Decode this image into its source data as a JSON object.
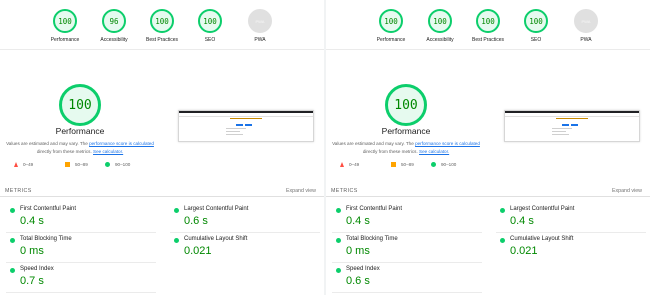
{
  "reports": [
    {
      "gauges": [
        {
          "score": "100",
          "label": "Performance"
        },
        {
          "score": "96",
          "label": "Accessibility"
        },
        {
          "score": "100",
          "label": "Best Practices"
        },
        {
          "score": "100",
          "label": "SEO"
        },
        {
          "score": "PWA",
          "label": "PWA"
        }
      ],
      "hero": {
        "score": "100",
        "title": "Performance",
        "desc_prefix": "Values are estimated and may vary. The ",
        "desc_link1": "performance score is calculated",
        "desc_middle": " directly from these metrics. ",
        "desc_link2": "See calculator."
      },
      "legend": {
        "fail": "0–49",
        "average": "50–89",
        "pass": "90–100"
      },
      "metrics_title": "METRICS",
      "expand_label": "Expand view",
      "metrics": [
        {
          "label": "First Contentful Paint",
          "value": "0.4 s"
        },
        {
          "label": "Largest Contentful Paint",
          "value": "0.6 s"
        },
        {
          "label": "Total Blocking Time",
          "value": "0 ms"
        },
        {
          "label": "Cumulative Layout Shift",
          "value": "0.021"
        },
        {
          "label": "Speed Index",
          "value": "0.7 s"
        }
      ]
    },
    {
      "gauges": [
        {
          "score": "100",
          "label": "Performance"
        },
        {
          "score": "100",
          "label": "Accessibility"
        },
        {
          "score": "100",
          "label": "Best Practices"
        },
        {
          "score": "100",
          "label": "SEO"
        },
        {
          "score": "PWA",
          "label": "PWA"
        }
      ],
      "hero": {
        "score": "100",
        "title": "Performance",
        "desc_prefix": "Values are estimated and may vary. The ",
        "desc_link1": "performance score is calculated",
        "desc_middle": " directly from these metrics. ",
        "desc_link2": "See calculator."
      },
      "legend": {
        "fail": "0–49",
        "average": "50–89",
        "pass": "90–100"
      },
      "metrics_title": "METRICS",
      "expand_label": "Expand view",
      "metrics": [
        {
          "label": "First Contentful Paint",
          "value": "0.4 s"
        },
        {
          "label": "Largest Contentful Paint",
          "value": "0.4 s"
        },
        {
          "label": "Total Blocking Time",
          "value": "0 ms"
        },
        {
          "label": "Cumulative Layout Shift",
          "value": "0.021"
        },
        {
          "label": "Speed Index",
          "value": "0.6 s"
        }
      ]
    }
  ],
  "colors": {
    "pass": "#0cce6b",
    "pass_text": "#008800",
    "average": "#ffa400",
    "fail": "#ff4e42",
    "link": "#1a73e8"
  }
}
